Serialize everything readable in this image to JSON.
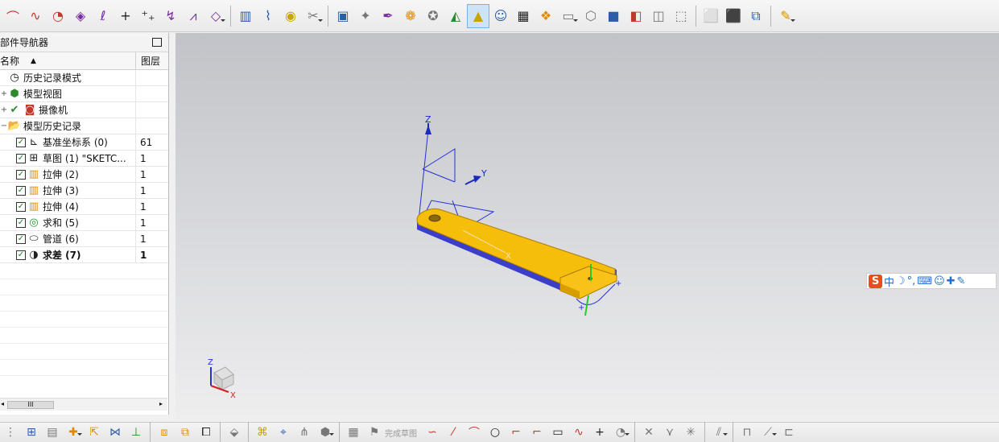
{
  "toolbar_top": {
    "groups": [
      [
        "arc-icon",
        "spline-icon",
        "shape-icon",
        "plane-icon",
        "curve-icon",
        "plus-icon",
        "points-icon",
        "offset-icon",
        "rib-icon",
        "datum-icon"
      ],
      [
        "cylinder-icon",
        "spring-icon",
        "gear-icon",
        "tool-icon"
      ],
      [
        "camera-icon",
        "measure-icon",
        "paint-icon",
        "color-icon",
        "light-icon",
        "flashlight-icon",
        "bulb-icon",
        "person-icon",
        "scene-icon",
        "material-icon",
        "screen-icon",
        "cube-icon",
        "box-icon",
        "render-icon",
        "wire-icon",
        "outline-icon"
      ],
      [
        "frame-icon",
        "shape3d-icon",
        "export-icon"
      ],
      [
        "edit-icon"
      ]
    ]
  },
  "navigator": {
    "title": "部件导航器",
    "col_name": "名称",
    "col_layer": "图层",
    "rows": [
      {
        "label": "历史记录模式",
        "layer": "",
        "icon": "clock-icon",
        "checked": false,
        "level": 0
      },
      {
        "label": "模型视图",
        "layer": "",
        "icon": "model-view-icon",
        "checked": false,
        "level": 0
      },
      {
        "label": "摄像机",
        "layer": "",
        "icon": "camera-icon",
        "checked": true,
        "level": 0
      },
      {
        "label": "模型历史记录",
        "layer": "",
        "icon": "folder-icon",
        "checked": false,
        "level": 0
      },
      {
        "label": "基准坐标系 (0)",
        "layer": "61",
        "icon": "datum-csys-icon",
        "checked": true,
        "level": 1
      },
      {
        "label": "草图 (1) \"SKETC...",
        "layer": "1",
        "icon": "sketch-icon",
        "checked": true,
        "level": 1
      },
      {
        "label": "拉伸 (2)",
        "layer": "1",
        "icon": "extrude-icon",
        "checked": true,
        "level": 1
      },
      {
        "label": "拉伸 (3)",
        "layer": "1",
        "icon": "extrude-icon",
        "checked": true,
        "level": 1
      },
      {
        "label": "拉伸 (4)",
        "layer": "1",
        "icon": "extrude-icon",
        "checked": true,
        "level": 1
      },
      {
        "label": "求和 (5)",
        "layer": "1",
        "icon": "unite-icon",
        "checked": true,
        "level": 1
      },
      {
        "label": "管道 (6)",
        "layer": "1",
        "icon": "tube-icon",
        "checked": true,
        "level": 1
      },
      {
        "label": "求差 (7)",
        "layer": "1",
        "icon": "subtract-icon",
        "checked": true,
        "level": 1
      }
    ],
    "scroll_grip": "III"
  },
  "viewport": {
    "axis_z": "Z",
    "axis_y": "Y",
    "axis_x": "X",
    "triad_z": "Z",
    "triad_x": "X",
    "part_color": "#f5be0b",
    "background_top": "#c2c3c8",
    "background_bottom": "#eeeeef"
  },
  "ime_bar": {
    "logo": "S",
    "mode": "中",
    "moon": "☽",
    "punct": "°,",
    "keyboard": "⌨",
    "person": "☺",
    "shirt": "✚",
    "wrench": "✎"
  },
  "toolbar_bottom": {
    "finish_sketch_label": "完成草图"
  }
}
